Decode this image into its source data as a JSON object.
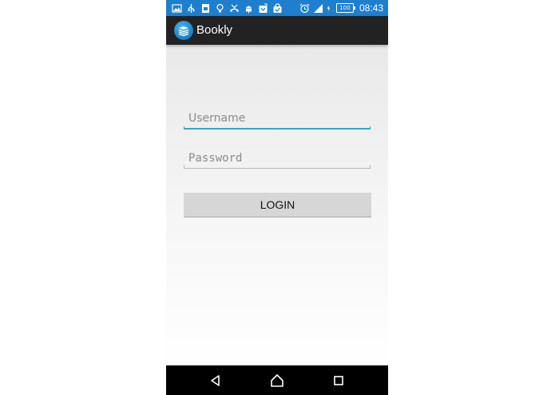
{
  "status_bar": {
    "icons": [
      "gallery-icon",
      "usb-icon",
      "sim-icon",
      "lightbulb-icon",
      "missed-call-icon",
      "android-debug-icon",
      "download-icon",
      "store-icon",
      "alarm-icon",
      "signal-icon",
      "charging-icon"
    ],
    "battery": "100",
    "time": "08:43",
    "color": "#1f7fcd"
  },
  "app_bar": {
    "title": "Bookly",
    "logo_icon": "book-stack-icon",
    "color": "#222222"
  },
  "login_form": {
    "username_placeholder": "Username",
    "username_value": "",
    "password_placeholder": "Password",
    "password_value": "",
    "login_label": "LOGIN",
    "accent_color": "#33a6cf"
  },
  "nav_bar": {
    "back_icon": "back-triangle-icon",
    "home_icon": "home-icon",
    "recents_icon": "recents-square-icon"
  }
}
